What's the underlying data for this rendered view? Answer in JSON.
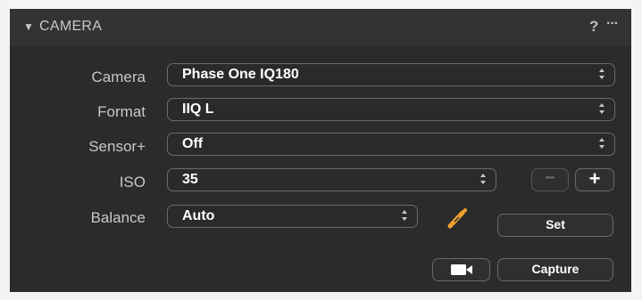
{
  "panel": {
    "title": "CAMERA",
    "expanded_icon": "triangle-down-icon",
    "help_label": "?",
    "more_label": "···"
  },
  "rows": {
    "camera": {
      "label": "Camera",
      "value": "Phase One IQ180"
    },
    "format": {
      "label": "Format",
      "value": "IIQ L"
    },
    "sensor": {
      "label": "Sensor+",
      "value": "Off"
    },
    "iso": {
      "label": "ISO",
      "value": "35",
      "minus_label": "−",
      "plus_label": "+"
    },
    "balance": {
      "label": "Balance",
      "value": "Auto",
      "set_label": "Set",
      "picker_icon": "eyedropper-icon"
    }
  },
  "capture": {
    "video_icon": "video-camera-icon",
    "capture_label": "Capture"
  },
  "colors": {
    "panel_bg": "#2b2b2b",
    "header_bg": "#333333",
    "text": "#c8c8c8",
    "value": "#ffffff",
    "accent_eyedropper": "#f0a030",
    "border": "#6a6a6a"
  }
}
